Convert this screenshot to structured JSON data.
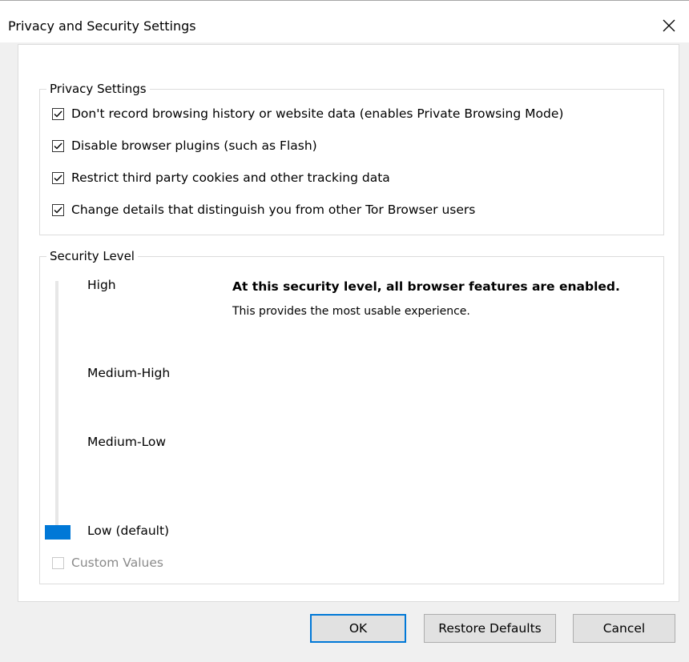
{
  "window": {
    "title": "Privacy and Security Settings"
  },
  "privacy": {
    "legend": "Privacy Settings",
    "options": [
      {
        "label": "Don't record browsing history or website data (enables Private Browsing Mode)",
        "checked": true
      },
      {
        "label": "Disable browser plugins (such as Flash)",
        "checked": true
      },
      {
        "label": "Restrict third party cookies and other tracking data",
        "checked": true
      },
      {
        "label": "Change details that distinguish you from other Tor Browser users",
        "checked": true
      }
    ]
  },
  "security": {
    "legend": "Security Level",
    "levels": [
      "High",
      "Medium-High",
      "Medium-Low",
      "Low (default)"
    ],
    "selected_level": "Low (default)",
    "heading": "At this security level, all browser features are enabled.",
    "description": "This provides the most usable experience.",
    "custom_label": "Custom Values",
    "custom_checked": false,
    "custom_enabled": false
  },
  "buttons": {
    "ok": "OK",
    "restore": "Restore Defaults",
    "cancel": "Cancel"
  },
  "colors": {
    "accent": "#0078d7",
    "client_bg": "#f0f0f0",
    "button_bg": "#e1e1e1"
  },
  "icons": {
    "close": "close-icon",
    "check": "checkmark-icon"
  }
}
